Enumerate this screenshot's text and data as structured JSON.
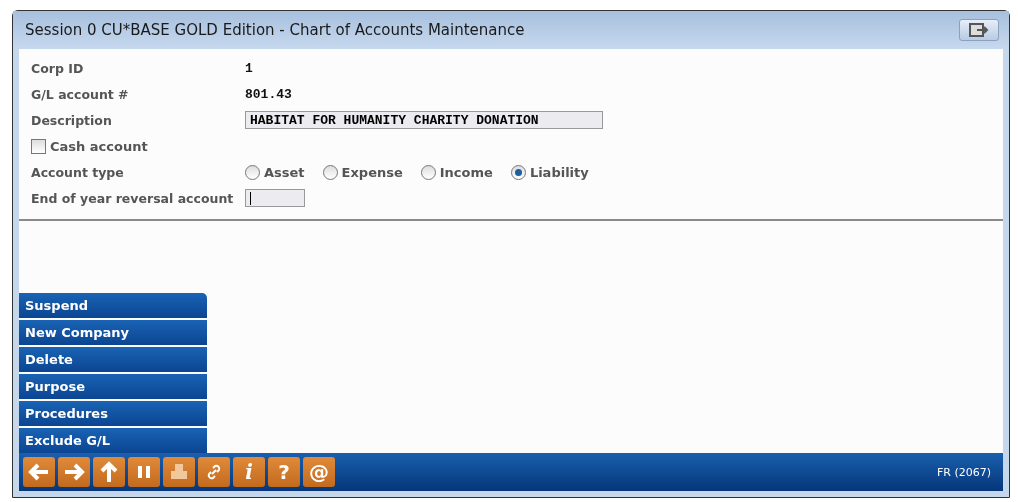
{
  "window": {
    "title": "Session 0 CU*BASE GOLD Edition - Chart of Accounts Maintenance"
  },
  "fields": [
    {
      "kind": "text",
      "label": "Corp ID",
      "value": "1"
    },
    {
      "kind": "text",
      "label": "G/L account #",
      "value": "801.43"
    },
    {
      "kind": "input",
      "label": "Description",
      "value": "HABITAT FOR HUMANITY CHARITY DONATION"
    },
    {
      "kind": "checkbox",
      "label": "Cash account",
      "checked": false
    },
    {
      "kind": "radio",
      "label": "Account type",
      "options": [
        {
          "label": "Asset",
          "selected": false
        },
        {
          "label": "Expense",
          "selected": false
        },
        {
          "label": "Income",
          "selected": false
        },
        {
          "label": "Liability",
          "selected": true
        }
      ]
    },
    {
      "kind": "input",
      "label": "End of year reversal account"
    }
  ],
  "actions": [
    "Suspend",
    "New Company",
    "Delete",
    "Purpose",
    "Procedures",
    "Exclude G/L"
  ],
  "toolbar": [
    {
      "kind": "back"
    },
    {
      "kind": "forward"
    },
    {
      "kind": "up"
    },
    {
      "kind": "pause"
    },
    {
      "kind": "print",
      "disabled": true
    },
    {
      "kind": "link"
    },
    {
      "kind": "glyph",
      "label": "i",
      "italic": true
    },
    {
      "kind": "glyph",
      "label": "?"
    },
    {
      "kind": "glyph",
      "label": "@"
    }
  ],
  "status_code": "FR (2067)"
}
